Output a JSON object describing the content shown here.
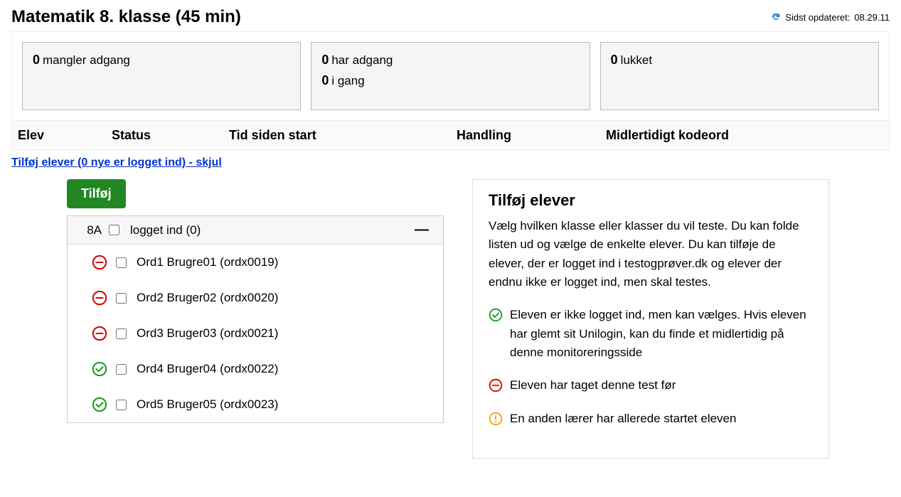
{
  "page": {
    "title": "Matematik 8. klasse (45 min)"
  },
  "updated": {
    "prefix": "Sidst opdateret:",
    "time": "08.29.11"
  },
  "cards": [
    {
      "rows": [
        {
          "count": "0",
          "label": "mangler adgang"
        }
      ]
    },
    {
      "rows": [
        {
          "count": "0",
          "label": "har adgang"
        },
        {
          "count": "0",
          "label": "i gang"
        }
      ]
    },
    {
      "rows": [
        {
          "count": "0",
          "label": "lukket"
        }
      ]
    }
  ],
  "columns": {
    "elev": "Elev",
    "status": "Status",
    "tid": "Tid siden start",
    "handling": "Handling",
    "kodeord": "Midlertidigt kodeord"
  },
  "addLink": "Tilføj elever (0 nye er logget ind) - skjul",
  "addButton": "Tilføj",
  "classRow": {
    "name": "8A",
    "label": "logget ind (0)"
  },
  "students": [
    {
      "status": "taken",
      "name": "Ord1 Brugre01 (ordx0019)"
    },
    {
      "status": "taken",
      "name": "Ord2 Bruger02 (ordx0020)"
    },
    {
      "status": "taken",
      "name": "Ord3 Bruger03 (ordx0021)"
    },
    {
      "status": "ok",
      "name": "Ord4 Bruger04 (ordx0022)"
    },
    {
      "status": "ok",
      "name": "Ord5 Bruger05 (ordx0023)"
    }
  ],
  "help": {
    "title": "Tilføj elever",
    "intro": "Vælg hvilken klasse eller klasser du vil teste. Du kan folde listen ud og vælge de enkelte elever. Du kan tilføje de elever, der er logget ind i testogprøver.dk og elever der endnu ikke er logget ind, men skal testes.",
    "legend_ok": "Eleven er ikke logget ind, men kan vælges. Hvis eleven har glemt sit Unilogin, kan du finde et midlertidig på denne monitoreringsside",
    "legend_taken": "Eleven har taget denne test før",
    "legend_started": "En anden lærer har allerede startet eleven"
  }
}
